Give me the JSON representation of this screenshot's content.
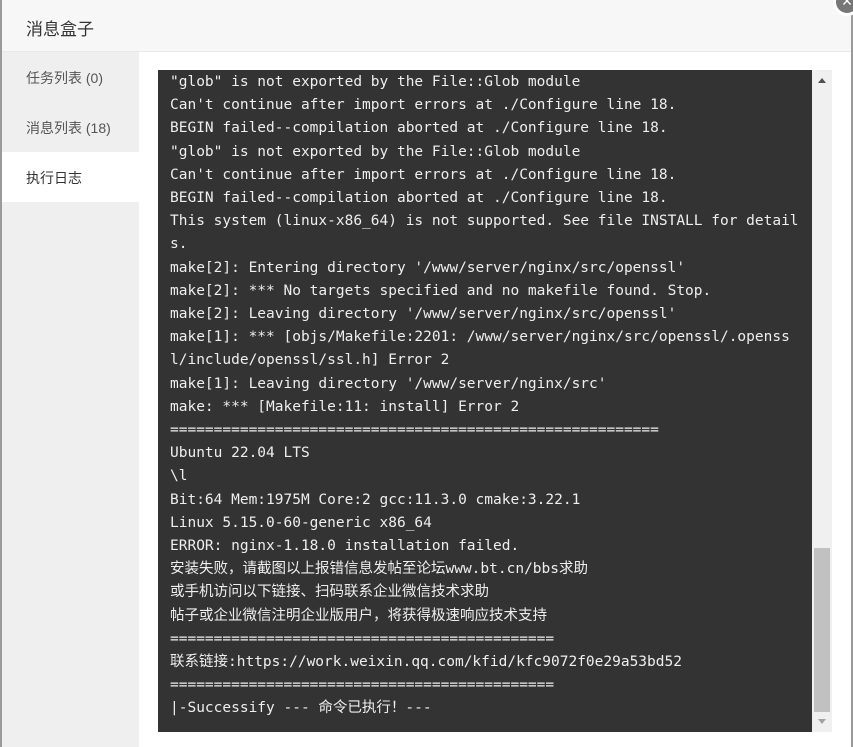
{
  "header": {
    "title": "消息盒子",
    "close_icon": "close-icon"
  },
  "sidebar": {
    "tabs": [
      {
        "label": "任务列表 (0)",
        "active": false
      },
      {
        "label": "消息列表 (18)",
        "active": false
      },
      {
        "label": "执行日志",
        "active": true
      }
    ]
  },
  "log": {
    "lines": [
      "\"glob\" is not exported by the File::Glob module",
      "Can't continue after import errors at ./Configure line 18.",
      "BEGIN failed--compilation aborted at ./Configure line 18.",
      "\"glob\" is not exported by the File::Glob module",
      "Can't continue after import errors at ./Configure line 18.",
      "BEGIN failed--compilation aborted at ./Configure line 18.",
      "This system (linux-x86_64) is not supported. See file INSTALL for details.",
      "make[2]: Entering directory '/www/server/nginx/src/openssl'",
      "make[2]: *** No targets specified and no makefile found. Stop.",
      "make[2]: Leaving directory '/www/server/nginx/src/openssl'",
      "make[1]: *** [objs/Makefile:2201: /www/server/nginx/src/openssl/.openssl/include/openssl/ssl.h] Error 2",
      "make[1]: Leaving directory '/www/server/nginx/src'",
      "make: *** [Makefile:11: install] Error 2",
      "========================================================",
      "Ubuntu 22.04 LTS",
      "\\l",
      "Bit:64 Mem:1975M Core:2 gcc:11.3.0 cmake:3.22.1",
      "Linux 5.15.0-60-generic x86_64",
      "ERROR: nginx-1.18.0 installation failed.",
      "安装失败，请截图以上报错信息发帖至论坛www.bt.cn/bbs求助",
      "或手机访问以下链接、扫码联系企业微信技术求助",
      "帖子或企业微信注明企业版用户，将获得极速响应技术支持",
      "============================================",
      "联系链接:https://work.weixin.qq.com/kfid/kfc9072f0e29a53bd52",
      "============================================",
      "|-Successify --- 命令已执行！---"
    ]
  },
  "scrollbar": {
    "position_fraction": 1.0,
    "visible_fraction": 0.26
  },
  "colors": {
    "log_bg": "#333333",
    "log_text": "#eeeeee",
    "sidebar_bg": "#efefef",
    "header_bg": "#f7f7f7"
  }
}
